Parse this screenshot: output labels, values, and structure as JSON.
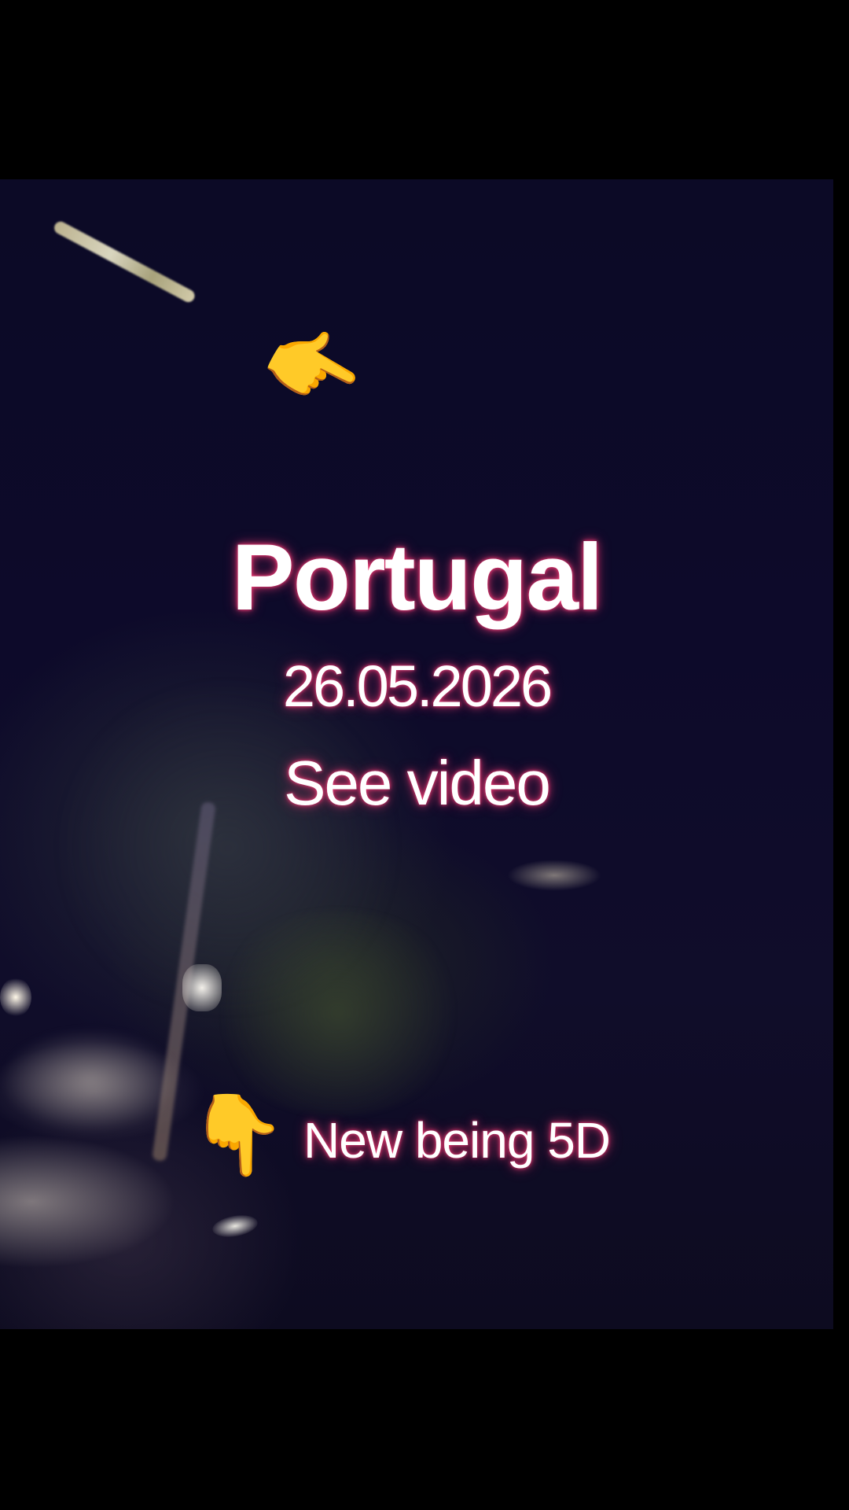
{
  "overlay": {
    "title": "Portugal",
    "date": "26.05.2026",
    "cta": "See video",
    "tagline": "New being 5D"
  },
  "icons": {
    "upper": "finger-pointing-icon",
    "lower": "finger-pointing-down-icon",
    "upper_glyph": "👈",
    "lower_glyph": "👇"
  },
  "colors": {
    "text": "#ffffff",
    "text_glow": "#ff3c78",
    "background": "#000000",
    "sky": "#0d0a2a"
  }
}
